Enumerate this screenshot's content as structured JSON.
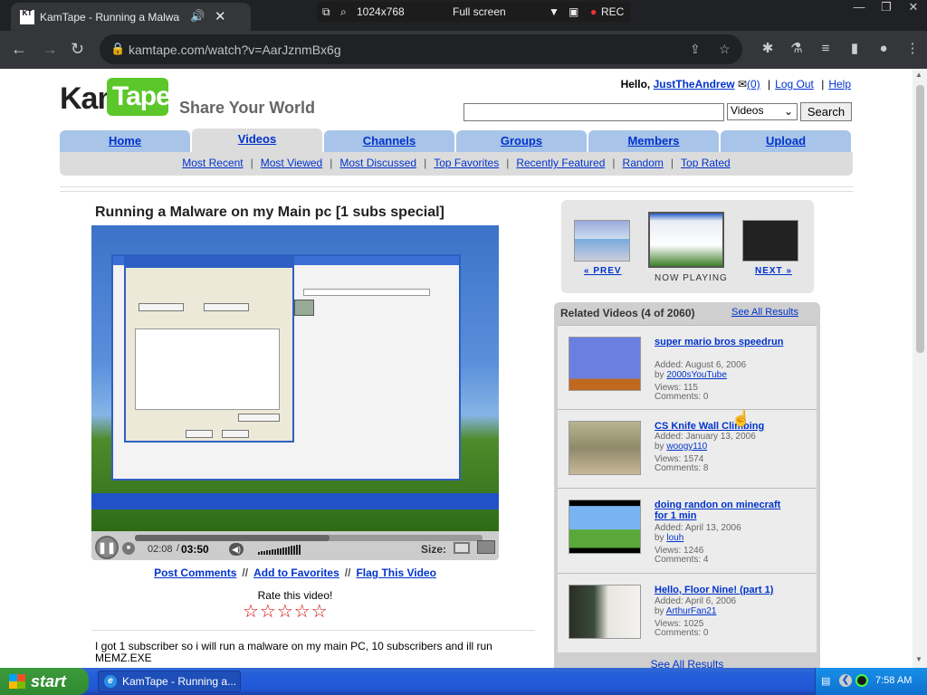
{
  "browser": {
    "tab_title": "KamTape - Running a Malware o",
    "tab_favicon": "KT",
    "url": "kamtape.com/watch?v=AarJznmBx6g",
    "recorder": {
      "resolution": "1024x768",
      "mode": "Full screen",
      "rec_label": "REC"
    }
  },
  "site": {
    "logo_left": "Kam",
    "logo_right": "Tape",
    "slogan": "Share Your World",
    "greeting": "Hello, ",
    "username": "JustTheAndrew",
    "inbox_count": "(0)",
    "logout": "Log Out",
    "help": "Help",
    "search": {
      "value": "",
      "select_value": "Videos",
      "button": "Search"
    },
    "tabs": [
      "Home",
      "Videos",
      "Channels",
      "Groups",
      "Members",
      "Upload"
    ],
    "active_tab": "Videos",
    "subnav": [
      "Most Recent",
      "Most Viewed",
      "Most Discussed",
      "Top Favorites",
      "Recently Featured",
      "Random",
      "Top Rated"
    ]
  },
  "video": {
    "title": "Running a Malware on my Main pc [1 subs special]",
    "time_current": "02:08",
    "time_sep": "/",
    "time_total": "03:50",
    "progress_fraction": 0.56,
    "size_label": "Size:",
    "actions": [
      "Post Comments",
      "Add to Favorites",
      "Flag This Video"
    ],
    "action_sep": "//",
    "rate_label": "Rate this video!",
    "stars": "☆☆☆☆☆",
    "description": "I got 1 subscriber so i will run a malware on my main PC, 10 subscribers and ill run MEMZ.EXE"
  },
  "navigator": {
    "prev": "« PREV",
    "now_playing": "NOW PLAYING",
    "next": "NEXT »"
  },
  "related": {
    "header": "Related Videos (4 of 2060)",
    "see_all": "See All Results",
    "items": [
      {
        "title": "super mario bros speedrun",
        "added": "Added: August 6, 2006",
        "by": "by ",
        "author": "2000sYouTube",
        "views": "Views: 115",
        "comments": "Comments: 0"
      },
      {
        "title": "CS Knife Wall Climbing",
        "added": "Added: January 13, 2006",
        "by": "by ",
        "author": "woogy110",
        "views": "Views: 1574",
        "comments": "Comments: 8"
      },
      {
        "title": "doing randon on minecraft for 1 min",
        "added": "Added: April 13, 2006",
        "by": "by ",
        "author": "louh",
        "views": "Views: 1246",
        "comments": "Comments: 4"
      },
      {
        "title": "Hello, Floor Nine! (part 1)",
        "added": "Added: April 6, 2006",
        "by": "by ",
        "author": "ArthurFan21",
        "views": "Views: 1025",
        "comments": "Comments: 0"
      }
    ]
  },
  "xp_taskbar": {
    "start": "start",
    "task_item": "KamTape - Running a...",
    "clock": "7:58 AM"
  },
  "colors": {
    "link": "#0033cc",
    "tab_blue": "#a8c4e8",
    "logo_green": "#5cc72a",
    "star_red": "#d40000"
  }
}
